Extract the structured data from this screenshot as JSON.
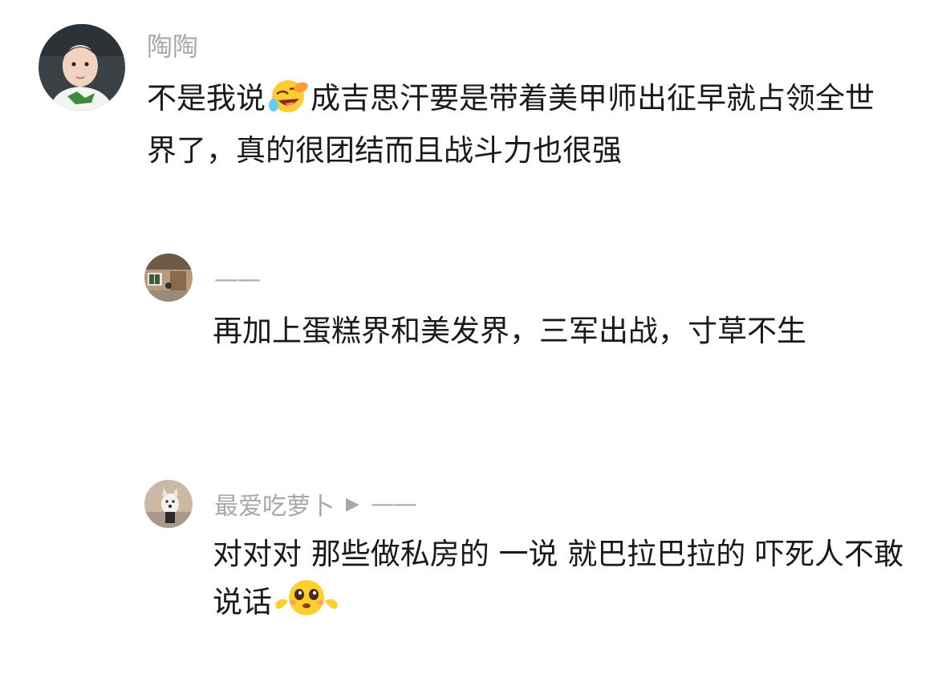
{
  "comments": [
    {
      "author": "陶陶",
      "text_before_emoji": "不是我说",
      "emoji": "rofl-emoji",
      "text_after_emoji": "成吉思汗要是带着美甲师出征早就占领全世界了，真的很团结而且战斗力也很强"
    },
    {
      "author": "——",
      "text": "再加上蛋糕界和美发界，三军出战，寸草不生"
    },
    {
      "author": "最爱吃萝卜",
      "reply_to": "——",
      "text_before_emoji": "对对对 那些做私房的 一说 就巴拉巴拉的 吓死人不敢说话",
      "emoji": "pleading-hug-emoji"
    }
  ],
  "colors": {
    "name": "#a8a8a8",
    "text": "#1a1a1a",
    "background": "#ffffff"
  }
}
